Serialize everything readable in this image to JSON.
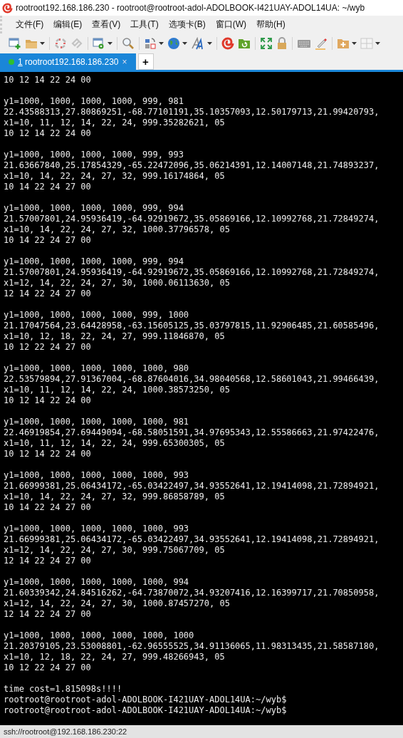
{
  "window": {
    "title": "rootroot192.168.186.230 - rootroot@rootroot-adol-ADOLBOOK-I421UAY-ADOL14UA: ~/wyb"
  },
  "menu": [
    "文件(F)",
    "编辑(E)",
    "查看(V)",
    "工具(T)",
    "选项卡(B)",
    "窗口(W)",
    "帮助(H)"
  ],
  "tabs": [
    {
      "number": "1",
      "label": "rootroot192.168.186.230",
      "selected": true,
      "connected": true,
      "close": "×"
    }
  ],
  "new_tab": "+",
  "terminal": {
    "blocks": [
      [
        "10 12 14 22 24 00"
      ],
      [
        "y1=1000, 1000, 1000, 1000, 999, 981",
        "22.43588313,27.80869251,-68.77101191,35.10357093,12.50179713,21.99420793,",
        "x1=10, 11, 12, 14, 22, 24, 999.35282621, 05",
        "10 12 14 22 24 00"
      ],
      [
        "y1=1000, 1000, 1000, 1000, 999, 993",
        "21.63667840,25.17854329,-65.22472096,35.06214391,12.14007148,21.74893237,",
        "x1=10, 14, 22, 24, 27, 32, 999.16174864, 05",
        "10 14 22 24 27 00"
      ],
      [
        "y1=1000, 1000, 1000, 1000, 999, 994",
        "21.57007801,24.95936419,-64.92919672,35.05869166,12.10992768,21.72849274,",
        "x1=10, 14, 22, 24, 27, 32, 1000.37796578, 05",
        "10 14 22 24 27 00"
      ],
      [
        "y1=1000, 1000, 1000, 1000, 999, 994",
        "21.57007801,24.95936419,-64.92919672,35.05869166,12.10992768,21.72849274,",
        "x1=12, 14, 22, 24, 27, 30, 1000.06113630, 05",
        "12 14 22 24 27 00"
      ],
      [
        "y1=1000, 1000, 1000, 1000, 999, 1000",
        "21.17047564,23.64428958,-63.15605125,35.03797815,11.92906485,21.60585496,",
        "x1=10, 12, 18, 22, 24, 27, 999.11846870, 05",
        "10 12 22 24 27 00"
      ],
      [
        "y1=1000, 1000, 1000, 1000, 1000, 980",
        "22.53579894,27.91367004,-68.87604016,34.98040568,12.58601043,21.99466439,",
        "x1=10, 11, 12, 14, 22, 24, 1000.38573250, 05",
        "10 12 14 22 24 00"
      ],
      [
        "y1=1000, 1000, 1000, 1000, 1000, 981",
        "22.46919854,27.69449094,-68.58051591,34.97695343,12.55586663,21.97422476,",
        "x1=10, 11, 12, 14, 22, 24, 999.65300305, 05",
        "10 12 14 22 24 00"
      ],
      [
        "y1=1000, 1000, 1000, 1000, 1000, 993",
        "21.66999381,25.06434172,-65.03422497,34.93552641,12.19414098,21.72894921,",
        "x1=10, 14, 22, 24, 27, 32, 999.86858789, 05",
        "10 14 22 24 27 00"
      ],
      [
        "y1=1000, 1000, 1000, 1000, 1000, 993",
        "21.66999381,25.06434172,-65.03422497,34.93552641,12.19414098,21.72894921,",
        "x1=12, 14, 22, 24, 27, 30, 999.75067709, 05",
        "12 14 22 24 27 00"
      ],
      [
        "y1=1000, 1000, 1000, 1000, 1000, 994",
        "21.60339342,24.84516262,-64.73870072,34.93207416,12.16399717,21.70850958,",
        "x1=12, 14, 22, 24, 27, 30, 1000.87457270, 05",
        "12 14 22 24 27 00"
      ],
      [
        "y1=1000, 1000, 1000, 1000, 1000, 1000",
        "21.20379105,23.53008801,-62.96555525,34.91136065,11.98313435,21.58587180,",
        "x1=10, 12, 18, 22, 24, 27, 999.48266943, 05",
        "10 12 22 24 27 00"
      ],
      [
        "time cost=1.815098s!!!!",
        "rootroot@rootroot-adol-ADOLBOOK-I421UAY-ADOL14UA:~/wyb$",
        "rootroot@rootroot-adol-ADOLBOOK-I421UAY-ADOL14UA:~/wyb$"
      ]
    ]
  },
  "status_bar": "ssh://rootroot@192.168.186.230:22"
}
